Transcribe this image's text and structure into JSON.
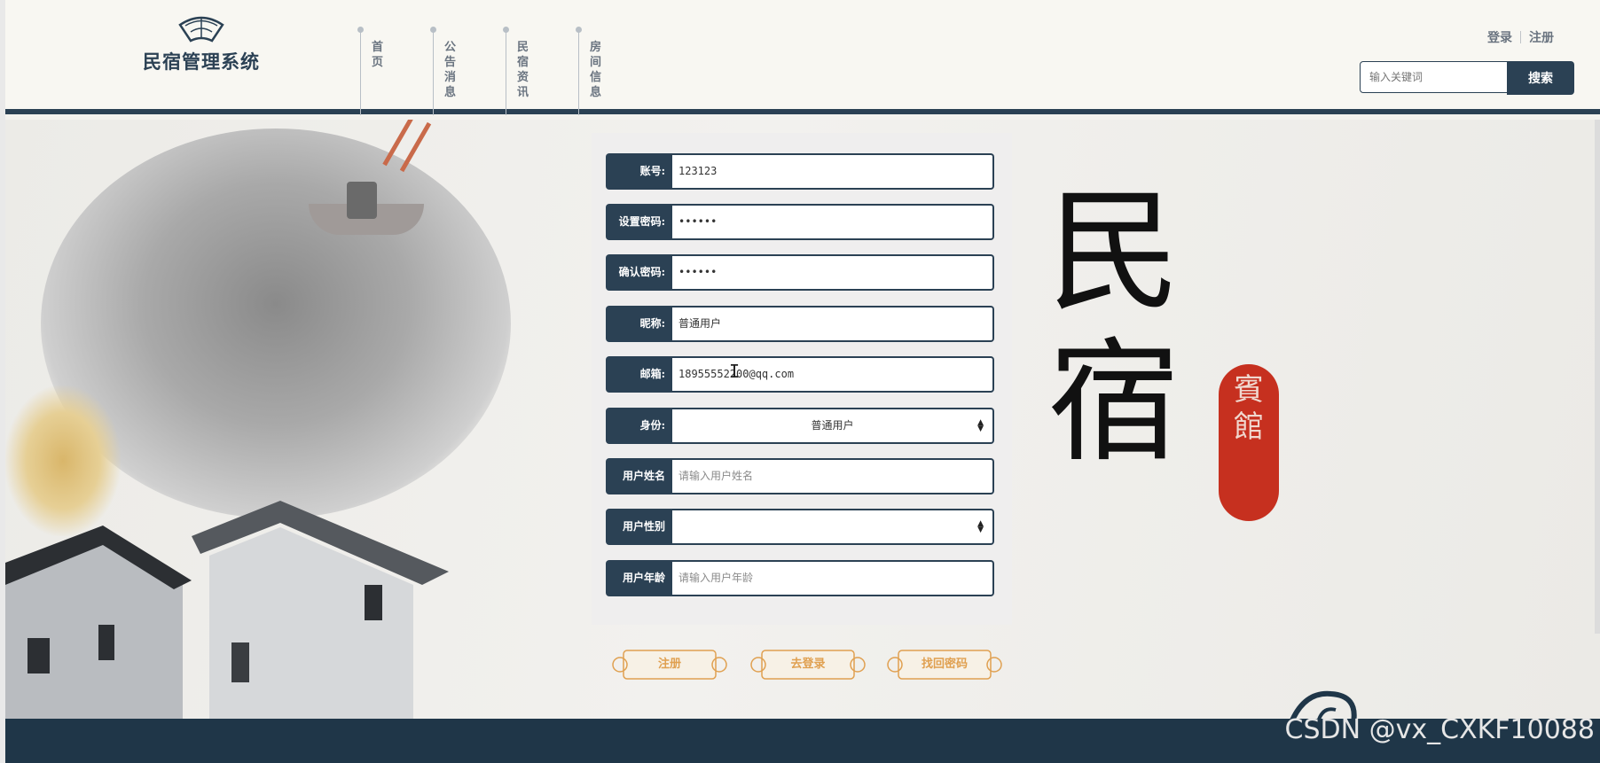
{
  "header": {
    "logo_text": "民宿管理系统",
    "nav": [
      {
        "label": "首页"
      },
      {
        "label": "公告消息"
      },
      {
        "label": "民宿资讯"
      },
      {
        "label": "房间信息"
      }
    ],
    "login_label": "登录",
    "register_link_label": "注册",
    "search_placeholder": "输入关键词",
    "search_button": "搜索"
  },
  "form": {
    "account": {
      "label": "账号:",
      "value": "123123"
    },
    "password": {
      "label": "设置密码:",
      "value": "••••••"
    },
    "confirm_password": {
      "label": "确认密码:",
      "value": "••••••"
    },
    "nickname": {
      "label": "昵称:",
      "value": "普通用户"
    },
    "email": {
      "label": "邮箱:",
      "value": "18955552200@qq.com"
    },
    "identity": {
      "label": "身份:",
      "value": "普通用户"
    },
    "real_name": {
      "label": "用户姓名",
      "placeholder": "请输入用户姓名"
    },
    "gender": {
      "label": "用户性别",
      "value": ""
    },
    "age": {
      "label": "用户年龄",
      "placeholder": "请输入用户年龄"
    }
  },
  "buttons": {
    "register": "注册",
    "go_login": "去登录",
    "recover_password": "找回密码"
  },
  "decoration": {
    "calligraphy": "民宿",
    "seal_text": "賓館"
  },
  "watermark": "CSDN @vx_CXKF10088",
  "colors": {
    "primary": "#2b4154",
    "seal": "#c6301f",
    "button_gold": "#e0a050"
  }
}
